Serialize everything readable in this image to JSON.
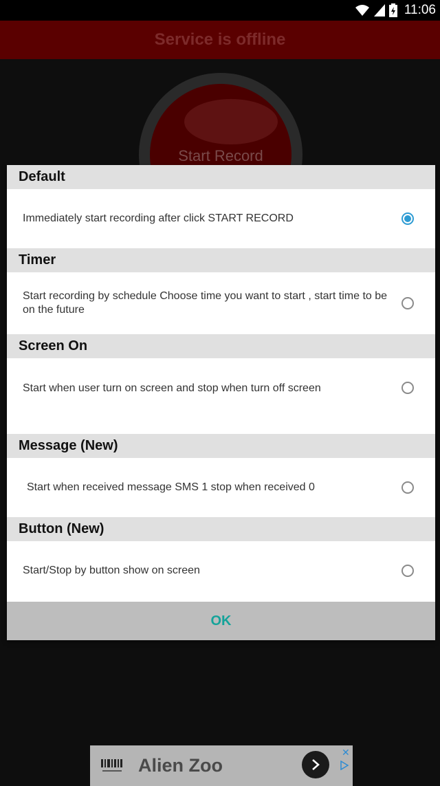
{
  "status_bar": {
    "time": "11:06",
    "icons": [
      "wifi-icon",
      "signal-icon",
      "battery-icon"
    ]
  },
  "app": {
    "header_title": "Service is offline",
    "record_button_label": "Start Record"
  },
  "dialog": {
    "sections": [
      {
        "header": "Default",
        "option": "Immediately start recording after click START RECORD",
        "checked": true
      },
      {
        "header": "Timer",
        "option": "Start recording by schedule Choose time you want to start , start time to be on the future",
        "checked": false
      },
      {
        "header": "Screen On",
        "option": "Start when user turn on screen and stop when turn off screen",
        "checked": false
      },
      {
        "header": "Message (New)",
        "option": "Start when received message SMS 1 stop when received 0",
        "checked": false
      },
      {
        "header": "Button (New)",
        "option": "Start/Stop by button show on screen",
        "checked": false
      }
    ],
    "ok_label": "OK"
  },
  "ad": {
    "title": "Alien Zoo"
  },
  "colors": {
    "accent_radio": "#2d9bd3",
    "ok_text": "#15a39a",
    "header_red": "#5a0000"
  }
}
